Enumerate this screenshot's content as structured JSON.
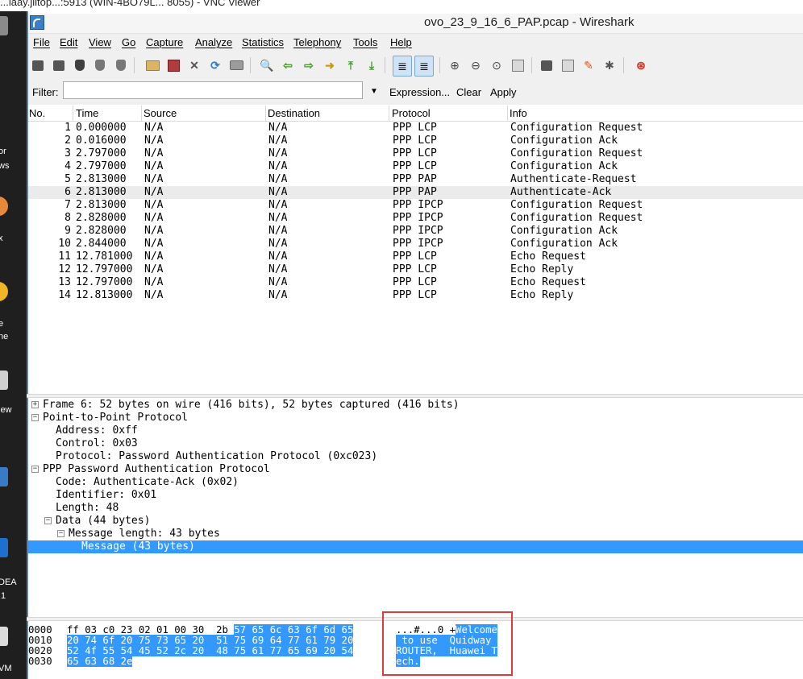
{
  "vnc_title": "...laay.jlitop...:5913 (WIN-4BO79L... 8055) - VNC Viewer",
  "desktop_labels": [
    "or",
    "ws",
    "x",
    "e",
    "ne",
    "iew",
    "DEA",
    ".1",
    "VM"
  ],
  "window": {
    "title": "ovo_23_9_16_6_PAP.pcap - Wireshark"
  },
  "menu": [
    "File",
    "Edit",
    "View",
    "Go",
    "Capture",
    "Analyze",
    "Statistics",
    "Telephony",
    "Tools",
    "Help"
  ],
  "toolbar_icons": [
    "interface-list-icon",
    "capture-options-icon",
    "start-capture-icon",
    "stop-capture-icon",
    "restart-capture-icon",
    "open-file-icon",
    "save-file-icon",
    "close-file-icon",
    "reload-icon",
    "print-icon",
    "find-packet-icon",
    "go-back-icon",
    "go-forward-icon",
    "go-to-packet-icon",
    "first-packet-icon",
    "last-packet-icon",
    "colorize-icon",
    "auto-scroll-icon",
    "zoom-in-icon",
    "zoom-out-icon",
    "normal-size-icon",
    "resize-columns-icon",
    "capture-filters-icon",
    "display-filters-icon",
    "coloring-rules-icon",
    "preferences-icon",
    "help-icon"
  ],
  "filter": {
    "label": "Filter:",
    "value": "",
    "expression": "Expression...",
    "clear": "Clear",
    "apply": "Apply"
  },
  "packet_list": {
    "columns": [
      "No.",
      "Time",
      "Source",
      "Destination",
      "Protocol",
      "Info"
    ],
    "selected_row": 6,
    "rows": [
      {
        "no": "1",
        "time": "0.000000",
        "source": "N/A",
        "destination": "N/A",
        "protocol": "PPP LCP",
        "info": "Configuration Request"
      },
      {
        "no": "2",
        "time": "0.016000",
        "source": "N/A",
        "destination": "N/A",
        "protocol": "PPP LCP",
        "info": "Configuration Ack"
      },
      {
        "no": "3",
        "time": "2.797000",
        "source": "N/A",
        "destination": "N/A",
        "protocol": "PPP LCP",
        "info": "Configuration Request"
      },
      {
        "no": "4",
        "time": "2.797000",
        "source": "N/A",
        "destination": "N/A",
        "protocol": "PPP LCP",
        "info": "Configuration Ack"
      },
      {
        "no": "5",
        "time": "2.813000",
        "source": "N/A",
        "destination": "N/A",
        "protocol": "PPP PAP",
        "info": "Authenticate-Request"
      },
      {
        "no": "6",
        "time": "2.813000",
        "source": "N/A",
        "destination": "N/A",
        "protocol": "PPP PAP",
        "info": "Authenticate-Ack"
      },
      {
        "no": "7",
        "time": "2.813000",
        "source": "N/A",
        "destination": "N/A",
        "protocol": "PPP IPCP",
        "info": "Configuration Request"
      },
      {
        "no": "8",
        "time": "2.828000",
        "source": "N/A",
        "destination": "N/A",
        "protocol": "PPP IPCP",
        "info": "Configuration Request"
      },
      {
        "no": "9",
        "time": "2.828000",
        "source": "N/A",
        "destination": "N/A",
        "protocol": "PPP IPCP",
        "info": "Configuration Ack"
      },
      {
        "no": "10",
        "time": "2.844000",
        "source": "N/A",
        "destination": "N/A",
        "protocol": "PPP IPCP",
        "info": "Configuration Ack"
      },
      {
        "no": "11",
        "time": "12.781000",
        "source": "N/A",
        "destination": "N/A",
        "protocol": "PPP LCP",
        "info": "Echo Request"
      },
      {
        "no": "12",
        "time": "12.797000",
        "source": "N/A",
        "destination": "N/A",
        "protocol": "PPP LCP",
        "info": "Echo Reply"
      },
      {
        "no": "13",
        "time": "12.797000",
        "source": "N/A",
        "destination": "N/A",
        "protocol": "PPP LCP",
        "info": "Echo Request"
      },
      {
        "no": "14",
        "time": "12.813000",
        "source": "N/A",
        "destination": "N/A",
        "protocol": "PPP LCP",
        "info": "Echo Reply"
      }
    ]
  },
  "details": [
    {
      "text": "Frame 6: 52 bytes on wire (416 bits), 52 bytes captured (416 bits)",
      "expander": "+"
    },
    {
      "text": "Point-to-Point Protocol",
      "expander": "−"
    },
    {
      "text": "Address: 0xff",
      "expander": ""
    },
    {
      "text": "Control: 0x03",
      "expander": ""
    },
    {
      "text": "Protocol: Password Authentication Protocol (0xc023)",
      "expander": ""
    },
    {
      "text": "PPP Password Authentication Protocol",
      "expander": "−"
    },
    {
      "text": "Code: Authenticate-Ack (0x02)",
      "expander": ""
    },
    {
      "text": "Identifier: 0x01",
      "expander": ""
    },
    {
      "text": "Length: 48",
      "expander": ""
    },
    {
      "text": "Data (44 bytes)",
      "expander": "−"
    },
    {
      "text": "Message length: 43 bytes",
      "expander": "−"
    },
    {
      "text": "Message (43 bytes)",
      "expander": ""
    }
  ],
  "hex": [
    {
      "offset": "0000",
      "bytes_plain": "ff 03 c0 23 02 01 00 30  2b ",
      "bytes_hl": "57 65 6c 63 6f 6d 65",
      "ascii_plain": "...#...0 +",
      "ascii_hl": "Welcome"
    },
    {
      "offset": "0010",
      "bytes_plain": "",
      "bytes_hl": "20 74 6f 20 75 73 65 20  51 75 69 64 77 61 79 20",
      "ascii_plain": "",
      "ascii_hl": " to use  Quidway "
    },
    {
      "offset": "0020",
      "bytes_plain": "",
      "bytes_hl": "52 4f 55 54 45 52 2c 20  48 75 61 77 65 69 20 54",
      "ascii_plain": "",
      "ascii_hl": "ROUTER,  Huawei T"
    },
    {
      "offset": "0030",
      "bytes_plain": "",
      "bytes_hl": "65 63 68 2e",
      "ascii_plain": "",
      "ascii_hl": "ech."
    }
  ]
}
